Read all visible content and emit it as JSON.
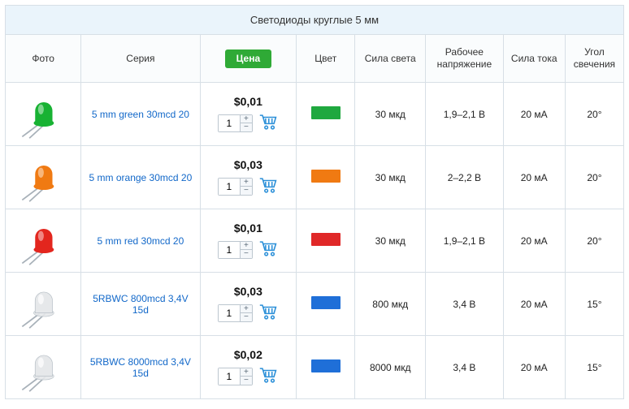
{
  "title": "Светодиоды круглые 5 мм",
  "columns": {
    "photo": "Фото",
    "series": "Серия",
    "price": "Цена",
    "color": "Цвет",
    "luminous": "Сила света",
    "voltage": "Рабочее напряжение",
    "current": "Сила тока",
    "angle": "Угол свечения"
  },
  "col_widths": [
    "88",
    "138",
    "112",
    "68",
    "82",
    "90",
    "72",
    "68"
  ],
  "rows": [
    {
      "led_color": "#18b233",
      "lens_clear": false,
      "series": "5 mm green 30mcd 20",
      "price": "$0,01",
      "qty": "1",
      "swatch": "#1fa83f",
      "luminous": "30 мкд",
      "voltage": "1,9–2,1 В",
      "current": "20 мА",
      "angle": "20°"
    },
    {
      "led_color": "#f07a12",
      "lens_clear": false,
      "series": "5 mm orange 30mcd 20",
      "price": "$0,03",
      "qty": "1",
      "swatch": "#f07a12",
      "luminous": "30 мкд",
      "voltage": "2–2,2 В",
      "current": "20 мА",
      "angle": "20°"
    },
    {
      "led_color": "#e3261e",
      "lens_clear": false,
      "series": "5 mm red 30mcd 20",
      "price": "$0,01",
      "qty": "1",
      "swatch": "#e02828",
      "luminous": "30 мкд",
      "voltage": "1,9–2,1 В",
      "current": "20 мА",
      "angle": "20°"
    },
    {
      "led_color": "#e6e8ea",
      "lens_clear": true,
      "series": "5RBWC 800mcd 3,4V 15d",
      "price": "$0,03",
      "qty": "1",
      "swatch": "#1f6fd8",
      "luminous": "800 мкд",
      "voltage": "3,4 В",
      "current": "20 мА",
      "angle": "15°"
    },
    {
      "led_color": "#e6e8ea",
      "lens_clear": true,
      "series": "5RBWC 8000mcd 3,4V 15d",
      "price": "$0,02",
      "qty": "1",
      "swatch": "#1f6fd8",
      "luminous": "8000 мкд",
      "voltage": "3,4 В",
      "current": "20 мА",
      "angle": "15°"
    }
  ]
}
